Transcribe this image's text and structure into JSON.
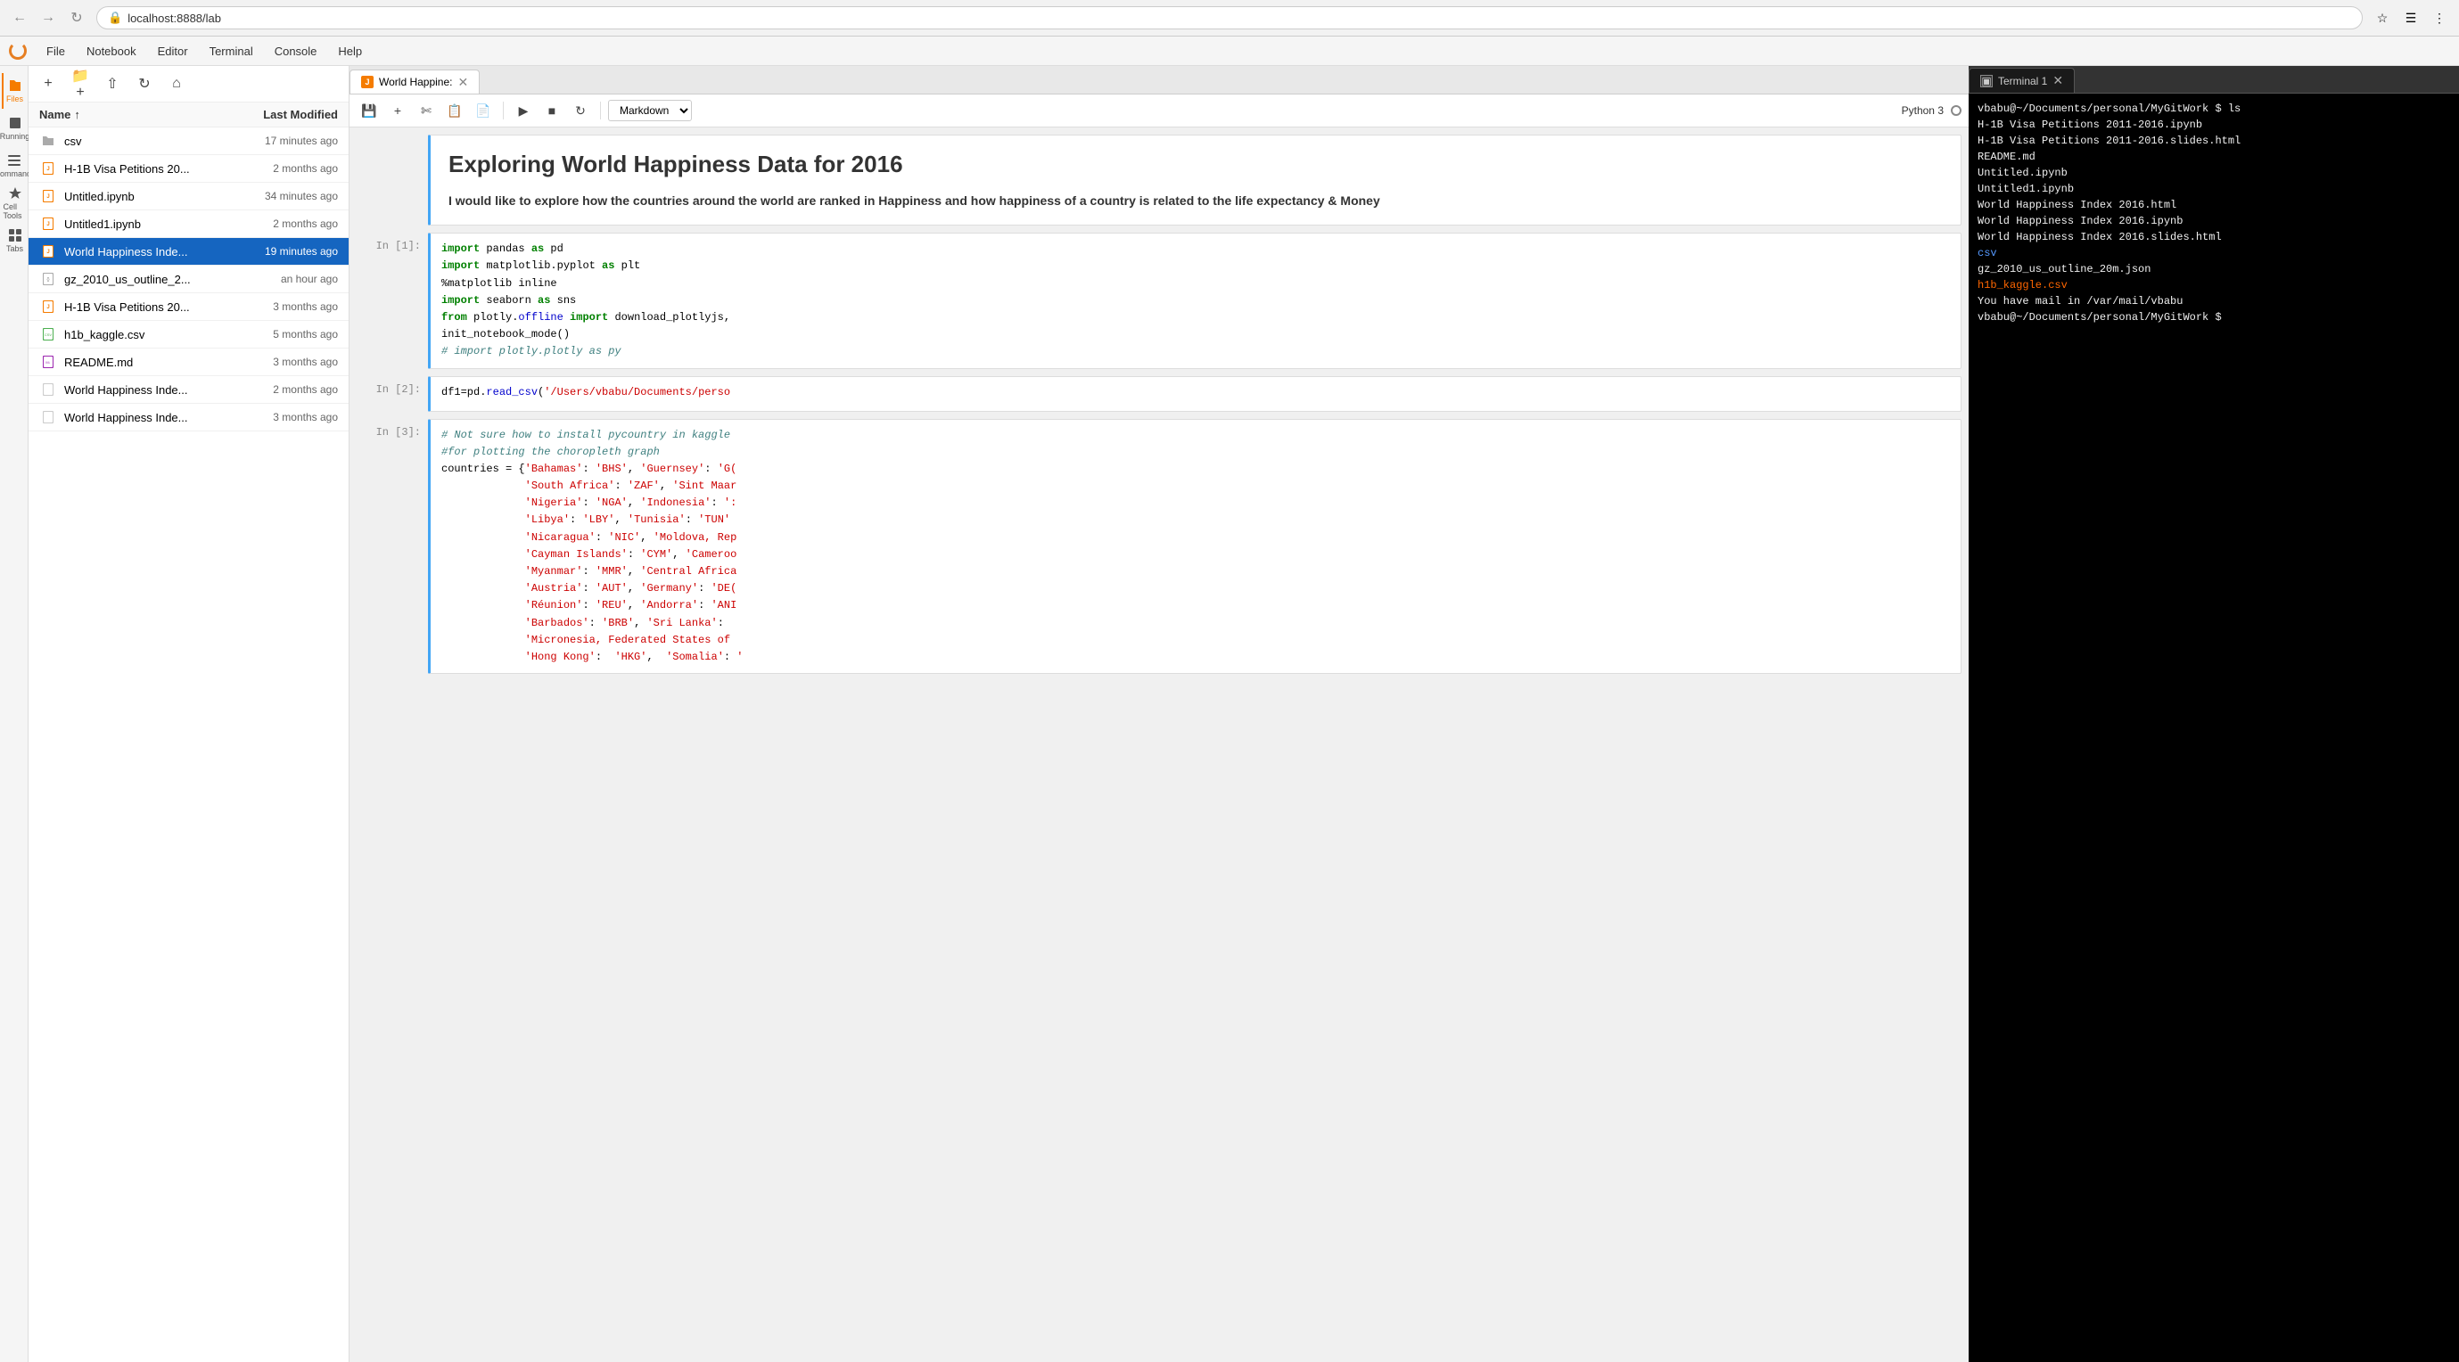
{
  "browser": {
    "url": "localhost:8888/lab",
    "back_btn": "←",
    "forward_btn": "→",
    "reload_btn": "↻"
  },
  "menu": {
    "items": [
      "File",
      "Notebook",
      "Editor",
      "Terminal",
      "Console",
      "Help"
    ]
  },
  "left_sidebar": {
    "icons": [
      {
        "name": "files",
        "label": "Files",
        "active": true,
        "icon": "📁"
      },
      {
        "name": "running",
        "label": "Running",
        "active": false,
        "icon": "⬛"
      },
      {
        "name": "commands",
        "label": "Commands",
        "active": false,
        "icon": "⌨"
      },
      {
        "name": "cell-tools",
        "label": "Cell Tools",
        "active": false,
        "icon": "🔧"
      },
      {
        "name": "tabs",
        "label": "Tabs",
        "active": false,
        "icon": "⊞"
      }
    ]
  },
  "file_panel": {
    "header_name": "Name",
    "header_modified": "Last Modified",
    "sort_arrow": "↑",
    "files": [
      {
        "name": "csv",
        "type": "folder",
        "time": "17 minutes ago"
      },
      {
        "name": "H-1B Visa Petitions 20...",
        "type": "notebook",
        "time": "2 months ago"
      },
      {
        "name": "Untitled.ipynb",
        "type": "notebook",
        "time": "34 minutes ago"
      },
      {
        "name": "Untitled1.ipynb",
        "type": "notebook",
        "time": "2 months ago"
      },
      {
        "name": "World Happiness Inde...",
        "type": "notebook",
        "time": "19 minutes ago",
        "active": true
      },
      {
        "name": "gz_2010_us_outline_2...",
        "type": "json",
        "time": "an hour ago"
      },
      {
        "name": "H-1B Visa Petitions 20...",
        "type": "notebook",
        "time": "3 months ago"
      },
      {
        "name": "h1b_kaggle.csv",
        "type": "csv",
        "time": "5 months ago"
      },
      {
        "name": "README.md",
        "type": "markdown",
        "time": "3 months ago"
      },
      {
        "name": "World Happiness Inde...",
        "type": "plain",
        "time": "2 months ago"
      },
      {
        "name": "World Happiness Inde...",
        "type": "plain",
        "time": "3 months ago"
      }
    ]
  },
  "notebook": {
    "tab_name": "World Happine:",
    "cell_type": "Markdown",
    "kernel": "Python 3",
    "cells": [
      {
        "type": "markdown",
        "prompt": "",
        "content_title": "Exploring World Happiness Data for 2016",
        "content_para": "I would like to explore how the countries around the world are ranked in Happiness and how happiness of a country is related to the life expectancy & Money"
      },
      {
        "type": "code",
        "prompt": "In [1]:",
        "lines": [
          "import pandas as pd",
          "import matplotlib.pyplot as plt",
          "%matplotlib inline",
          "import seaborn as sns",
          "from plotly.offline import download_plotlyjs,",
          "init_notebook_mode()",
          "# import plotly.plotly as py"
        ]
      },
      {
        "type": "code",
        "prompt": "In [2]:",
        "lines": [
          "df1=pd.read_csv('/Users/vbabu/Documents/perso"
        ]
      },
      {
        "type": "code",
        "prompt": "In [3]:",
        "lines": [
          "# Not sure how to install pycountry in kaggle",
          "#for plotting the choropleth graph",
          "",
          "countries = {'Bahamas': 'BHS', 'Guernsey': 'G(",
          "             'South Africa': 'ZAF', 'Sint Maar",
          "             'Nigeria': 'NGA', 'Indonesia': ':",
          "             'Libya': 'LBY', 'Tunisia': 'TUN'",
          "             'Nicaragua': 'NIC', 'Moldova, Rep",
          "             'Cayman Islands': 'CYM', 'Cameroo",
          "             'Myanmar': 'MMR', 'Central Africa",
          "             'Austria': 'AUT', 'Germany': 'DE(",
          "             'Réunion': 'REU', 'Andorra': 'ANI",
          "             'Barbados': 'BRB', 'Sri Lanka':",
          "             'Micronesia, Federated States of",
          "             'Hong Kong':  'HKG',  'Somalia': '"
        ]
      }
    ]
  },
  "terminal": {
    "tab_name": "Terminal 1",
    "lines": [
      {
        "text": "vbabu@~/Documents/personal/MyGitWork $ ls",
        "color": "normal"
      },
      {
        "text": "H-1B Visa Petitions 2011-2016.ipynb",
        "color": "normal"
      },
      {
        "text": "H-1B Visa Petitions 2011-2016.slides.html",
        "color": "normal"
      },
      {
        "text": "README.md",
        "color": "normal"
      },
      {
        "text": "Untitled.ipynb",
        "color": "normal"
      },
      {
        "text": "Untitled1.ipynb",
        "color": "normal"
      },
      {
        "text": "World Happiness Index 2016.html",
        "color": "normal"
      },
      {
        "text": "World Happiness Index 2016.ipynb",
        "color": "normal"
      },
      {
        "text": "World Happiness Index 2016.slides.html",
        "color": "normal"
      },
      {
        "text": "csv",
        "color": "blue"
      },
      {
        "text": "gz_2010_us_outline_20m.json",
        "color": "normal"
      },
      {
        "text": "h1b_kaggle.csv",
        "color": "orange"
      },
      {
        "text": "You have mail in /var/mail/vbabu",
        "color": "normal"
      },
      {
        "text": "vbabu@~/Documents/personal/MyGitWork $ ",
        "color": "normal"
      }
    ]
  }
}
